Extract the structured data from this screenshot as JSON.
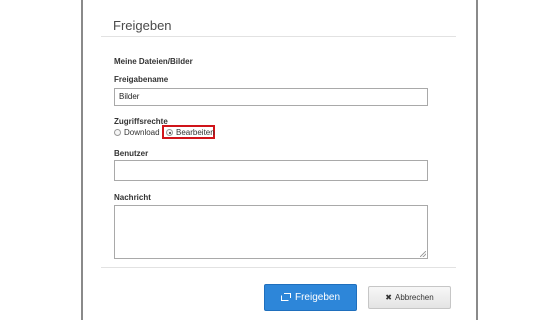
{
  "dialog": {
    "title": "Freigeben",
    "section_label": "Meine Dateien/Bilder"
  },
  "form": {
    "share_name_label": "Freigabename",
    "share_name_value": "Bilder",
    "rights_label": "Zugriffsrechte",
    "rights_options": [
      {
        "label": "Download",
        "selected": false
      },
      {
        "label": "Bearbeiten",
        "selected": true
      }
    ],
    "user_label": "Benutzer",
    "user_value": "",
    "message_label": "Nachricht",
    "message_value": ""
  },
  "buttons": {
    "share": "Freigeben",
    "cancel": "Abbrechen",
    "share_icon": "share-icon",
    "cancel_icon": "close-icon"
  },
  "colors": {
    "primary": "#2d86d9",
    "highlight": "#d0141a"
  }
}
